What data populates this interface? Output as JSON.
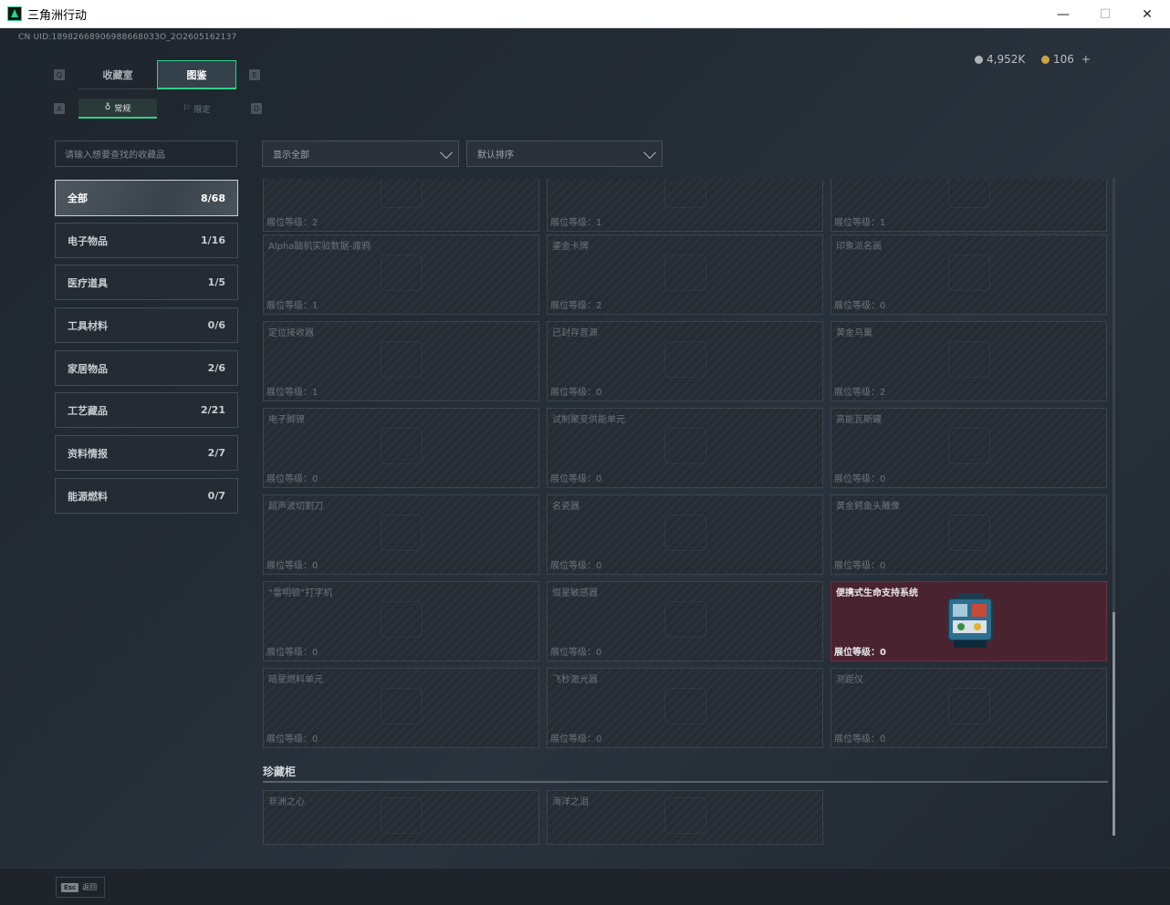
{
  "window": {
    "title": "三角洲行动",
    "minimize": "—",
    "maximize": "☐",
    "close": "✕"
  },
  "header": {
    "uid": "CN UID:18982668906988668033O_2O2605162137",
    "currency1": "4,952K",
    "currency2": "106",
    "add": "+"
  },
  "main_tabs": [
    {
      "label": "收藏室"
    },
    {
      "label": "图鉴"
    }
  ],
  "main_tabs_key_left": "Q",
  "main_tabs_key_right": "E",
  "sub_tabs": [
    {
      "label": "常规"
    },
    {
      "label": "限定"
    }
  ],
  "sub_tabs_key_left": "A",
  "sub_tabs_key_right": "D",
  "search": {
    "placeholder": "请输入想要查找的收藏品"
  },
  "filter": {
    "value": "显示全部"
  },
  "sort": {
    "value": "默认排序"
  },
  "categories": [
    {
      "label": "全部",
      "count": "8/68"
    },
    {
      "label": "电子物品",
      "count": "1/16"
    },
    {
      "label": "医疗道具",
      "count": "1/5"
    },
    {
      "label": "工具材料",
      "count": "0/6"
    },
    {
      "label": "家居物品",
      "count": "2/6"
    },
    {
      "label": "工艺藏品",
      "count": "2/21"
    },
    {
      "label": "资料情报",
      "count": "2/7"
    },
    {
      "label": "能源燃料",
      "count": "0/7"
    }
  ],
  "level_prefix": "展位等级：",
  "cards": [
    {
      "name": "",
      "level": "展位等级：2"
    },
    {
      "name": "",
      "level": "展位等级：1"
    },
    {
      "name": "",
      "level": "展位等级：1"
    },
    {
      "name": "Alpha脑机实验数据-渡鸦",
      "level": "展位等级：1"
    },
    {
      "name": "鎏金卡牌",
      "level": "展位等级：2"
    },
    {
      "name": "印象派名画",
      "level": "展位等级：0"
    },
    {
      "name": "定位接收器",
      "level": "展位等级：1"
    },
    {
      "name": "已封存音源",
      "level": "展位等级：0"
    },
    {
      "name": "黄金鸟巢",
      "level": "展位等级：2"
    },
    {
      "name": "电子脚镣",
      "level": "展位等级：0"
    },
    {
      "name": "试制聚变供能单元",
      "level": "展位等级：0"
    },
    {
      "name": "高能瓦斯罐",
      "level": "展位等级：0"
    },
    {
      "name": "超声波切割刀",
      "level": "展位等级：0"
    },
    {
      "name": "名瓷器",
      "level": "展位等级：0"
    },
    {
      "name": "黄金鳄鱼头雕像",
      "level": "展位等级：0"
    },
    {
      "name": "“雷明顿”打字机",
      "level": "展位等级：0"
    },
    {
      "name": "恒星敏感器",
      "level": "展位等级：0"
    },
    {
      "name": "便携式生命支持系统",
      "level": "展位等级：0",
      "highlight": true
    },
    {
      "name": "暗星燃料单元",
      "level": "展位等级：0"
    },
    {
      "name": "飞秒激光器",
      "level": "展位等级：0"
    },
    {
      "name": "测距仪",
      "level": "展位等级：0"
    }
  ],
  "section": {
    "title": "珍藏柜"
  },
  "cabinet": [
    {
      "name": "非洲之心"
    },
    {
      "name": "海洋之泪"
    }
  ],
  "footer": {
    "esc_key": "Esc",
    "esc_label": "返回"
  },
  "colors": {
    "accent": "#2fd18a",
    "highlight_card": "#4a2330"
  }
}
